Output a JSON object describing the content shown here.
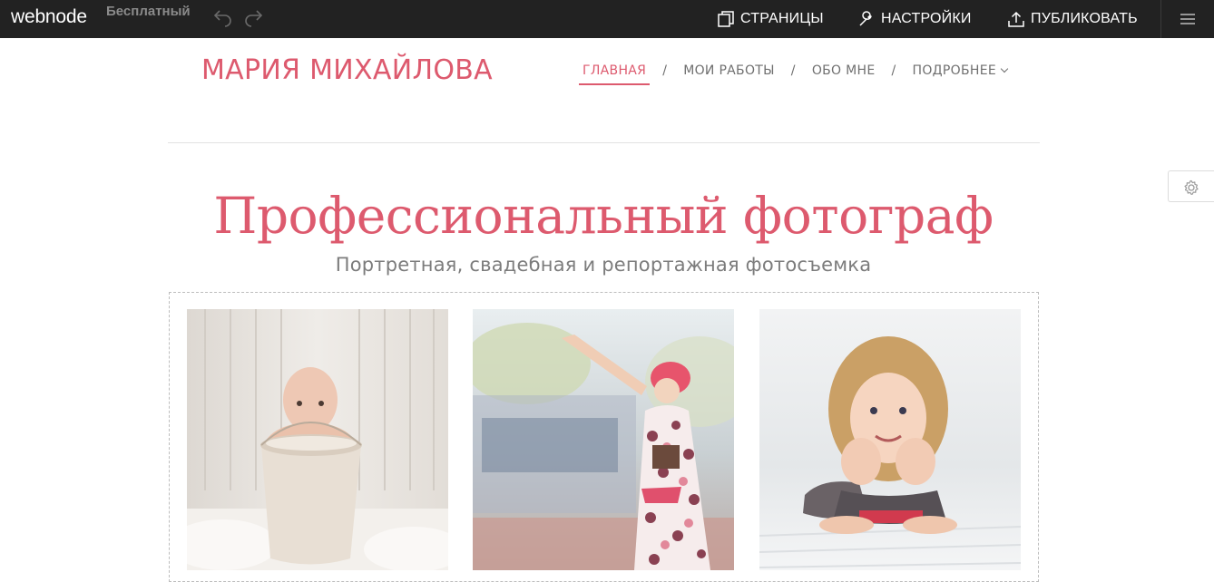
{
  "toolbar": {
    "logo": "webnode",
    "plan": "Бесплатный",
    "pages_label": "СТРАНИЦЫ",
    "settings_label": "НАСТРОЙКИ",
    "publish_label": "ПУБЛИКОВАТЬ",
    "icons": [
      "undo-icon",
      "redo-icon",
      "pages-icon",
      "wrench-icon",
      "upload-icon",
      "hamburger-icon"
    ]
  },
  "site": {
    "title": "МАРИЯ МИХАЙЛОВА",
    "nav": [
      {
        "label": "ГЛАВНАЯ",
        "active": true
      },
      {
        "label": "МОИ РАБОТЫ",
        "active": false
      },
      {
        "label": "ОБО МНЕ",
        "active": false
      },
      {
        "label": "ПОДРОБНЕЕ",
        "active": false
      }
    ],
    "nav_separator": "/",
    "accent_color": "#dd5a6e"
  },
  "hero": {
    "title": "Профессиональный фотограф",
    "subtitle": "Портретная, свадебная и репортажная фотосъемка"
  },
  "gallery": {
    "photos": [
      "baby-in-bucket-photo",
      "girl-hailing-taxi-photo",
      "smiling-girl-lying-photo"
    ]
  }
}
